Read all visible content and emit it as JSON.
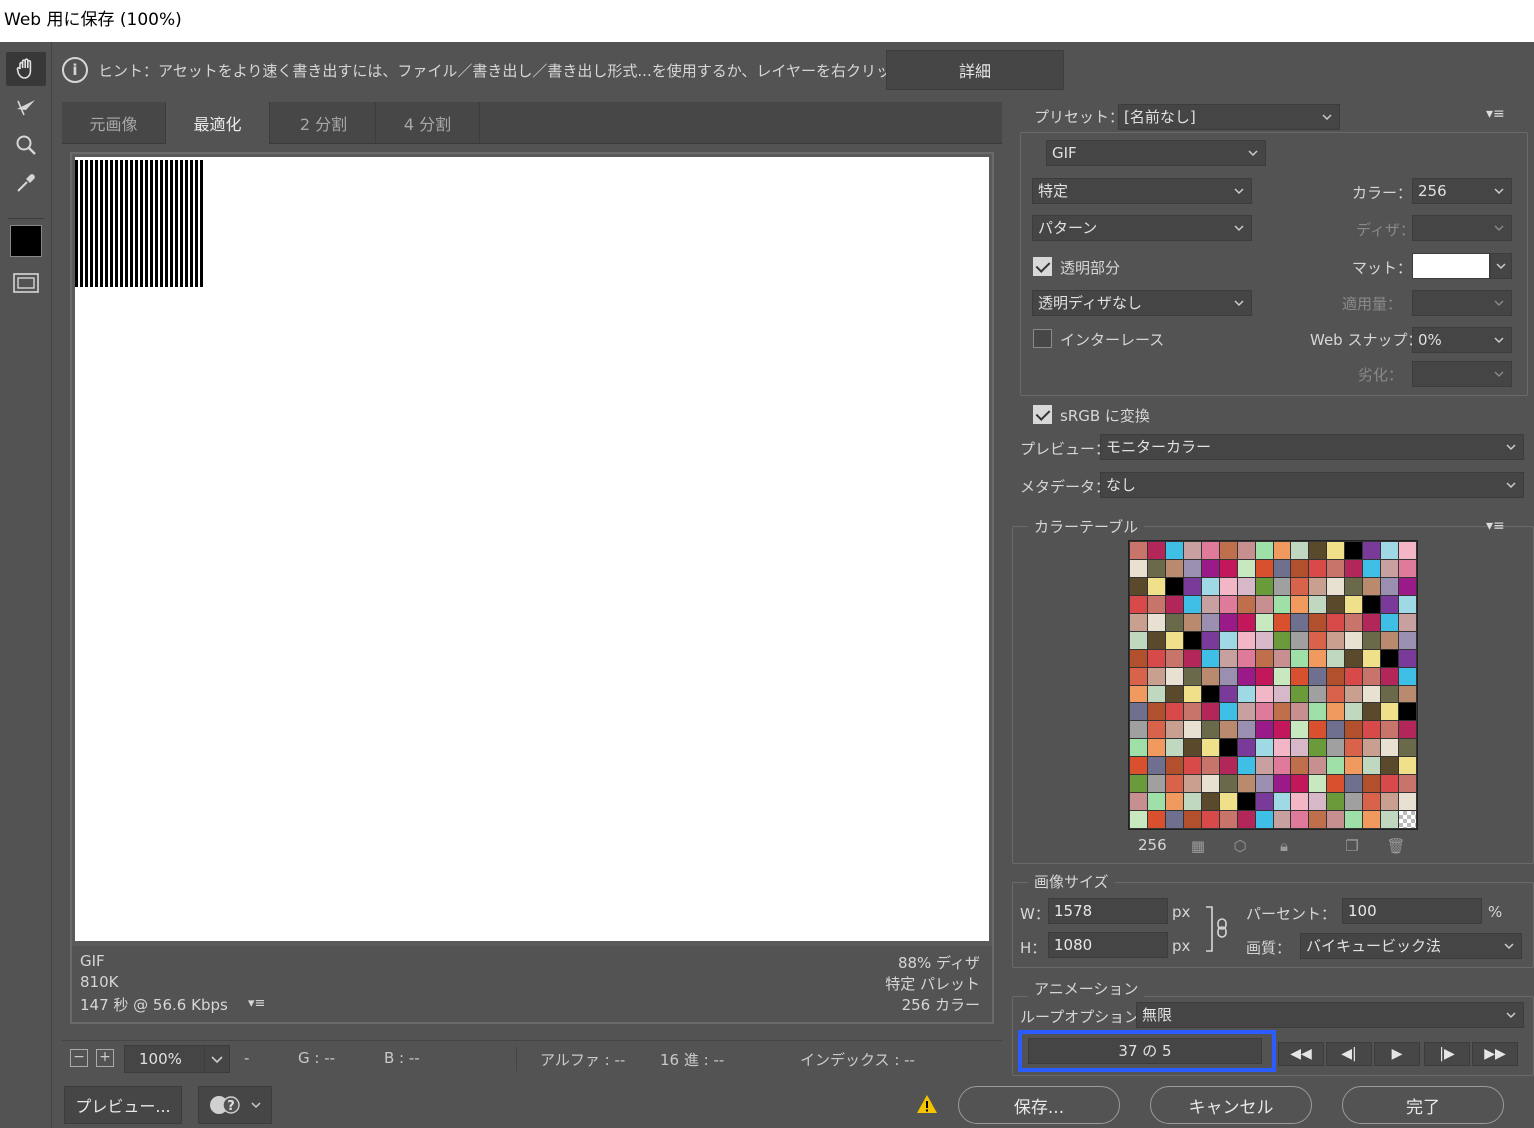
{
  "window": {
    "title": "Web 用に保存 (100%)"
  },
  "hint": {
    "text": "ヒント：アセットをより速く書き出すには、ファイル／書き出し／書き出し形式...を使用するか、レイヤーを右クリックして使用。",
    "detail_button": "詳細"
  },
  "tabs": [
    {
      "label": "元画像"
    },
    {
      "label": "最適化"
    },
    {
      "label": "2 分割"
    },
    {
      "label": "4 分割"
    }
  ],
  "canvas_info": {
    "format": "GIF",
    "size": "810K",
    "time": "147 秒 @ 56.6 Kbps",
    "dither": "88% ディザ",
    "palette": "特定 パレット",
    "colors": "256 カラー"
  },
  "statusbar": {
    "zoom": "100%",
    "r": "-",
    "g": "G : --",
    "b": "B : --",
    "alpha": "アルファ : --",
    "hex": "16 進 : --",
    "index": "インデックス : --"
  },
  "settings": {
    "preset_label": "プリセット：",
    "preset_value": "[名前なし]",
    "format": "GIF",
    "reduction": "特定",
    "dither_algo": "パターン",
    "colors_label": "カラー：",
    "colors_value": "256",
    "dither_label": "ディザ：",
    "transparency_label": "透明部分",
    "matte_label": "マット：",
    "transparency_dither": "透明ディザなし",
    "amount_label": "適用量：",
    "interlace_label": "インターレース",
    "websnap_label": "Web スナップ：",
    "websnap_value": "0%",
    "lossy_label": "劣化：",
    "srgb_label": "sRGB に変換",
    "preview_label": "プレビュー：",
    "preview_value": "モニターカラー",
    "metadata_label": "メタデータ：",
    "metadata_value": "なし"
  },
  "color_table": {
    "title": "カラーテーブル",
    "count": "256"
  },
  "image_size": {
    "title": "画像サイズ",
    "w_label": "W：",
    "w_value": "1578",
    "h_label": "H：",
    "h_value": "1080",
    "unit": "px",
    "percent_label": "パーセント：",
    "percent_value": "100",
    "percent_unit": "%",
    "quality_label": "画質：",
    "quality_value": "バイキュービック法"
  },
  "animation": {
    "title": "アニメーション",
    "loop_label": "ループオプション：",
    "loop_value": "無限",
    "frame_counter": "37 の 5"
  },
  "buttons": {
    "preview": "プレビュー...",
    "save": "保存...",
    "cancel": "キャンセル",
    "done": "完了"
  },
  "colors": {
    "highlight": "#2a5cff",
    "warning": "#f5c400"
  }
}
